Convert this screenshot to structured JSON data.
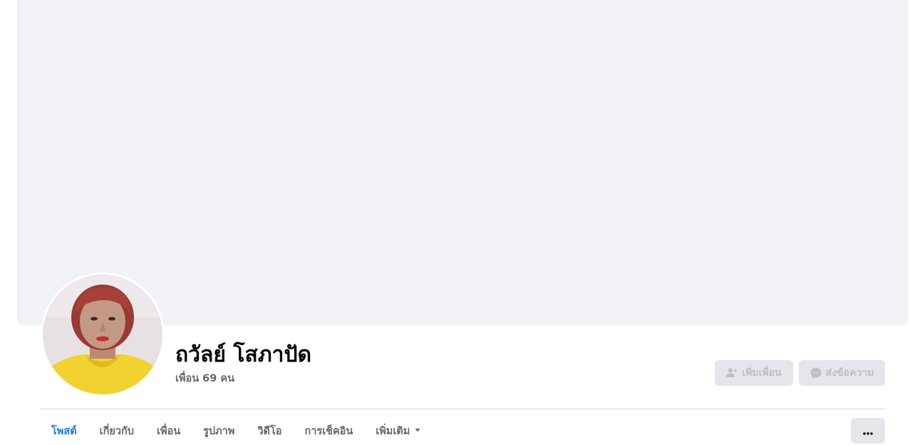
{
  "profile": {
    "name": "ถวัลย์ โสภาปัด",
    "friends_count": "เพื่อน 69 คน"
  },
  "actions": {
    "add_friend_label": "เพิ่มเพื่อน",
    "add_friend_icon": "add-friend-icon",
    "message_label": "ส่งข้อความ",
    "message_icon": "messenger-icon"
  },
  "tabs": [
    {
      "label": "โพสต์",
      "active": true
    },
    {
      "label": "เกี่ยวกับ",
      "active": false
    },
    {
      "label": "เพื่อน",
      "active": false
    },
    {
      "label": "รูปภาพ",
      "active": false
    },
    {
      "label": "วิดีโอ",
      "active": false
    },
    {
      "label": "การเช็คอิน",
      "active": false
    },
    {
      "label": "เพิ่มเติม",
      "active": false,
      "has_dropdown": true
    }
  ],
  "colors": {
    "accent": "#1877f2",
    "cover_bg": "#f0f2f5",
    "button_bg": "#e4e6eb",
    "disabled_text": "#bcc0c4",
    "secondary_text": "#65676b"
  }
}
